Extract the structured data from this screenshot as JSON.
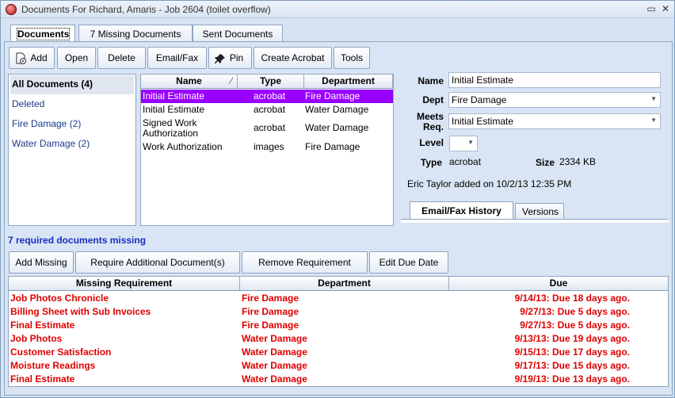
{
  "window": {
    "title": "Documents For Richard, Amaris - Job 2604 (toilet overflow)"
  },
  "tabs": [
    {
      "label": "Documents"
    },
    {
      "label": "7 Missing Documents"
    },
    {
      "label": "Sent Documents"
    }
  ],
  "toolbar": {
    "add": "Add",
    "open": "Open",
    "delete": "Delete",
    "email_fax": "Email/Fax",
    "pin": "Pin",
    "create_acrobat": "Create Acrobat",
    "tools": "Tools"
  },
  "categories": [
    {
      "label": "All Documents (4)"
    },
    {
      "label": "Deleted"
    },
    {
      "label": "Fire Damage (2)"
    },
    {
      "label": "Water Damage (2)"
    }
  ],
  "doc_grid": {
    "headers": {
      "name": "Name",
      "type": "Type",
      "department": "Department"
    },
    "rows": [
      {
        "name": "Initial Estimate",
        "type": "acrobat",
        "department": "Fire Damage"
      },
      {
        "name": "Initial Estimate",
        "type": "acrobat",
        "department": "Water Damage"
      },
      {
        "name": "Signed Work Authorization",
        "type": "acrobat",
        "department": "Water Damage"
      },
      {
        "name": "Work Authorization",
        "type": "images",
        "department": "Fire Damage"
      }
    ]
  },
  "details": {
    "name_label": "Name",
    "name_value": "Initial Estimate",
    "dept_label": "Dept",
    "dept_value": "Fire Damage",
    "meets_label_1": "Meets",
    "meets_label_2": "Req.",
    "meets_value": "Initial Estimate",
    "level_label": "Level",
    "level_value": "",
    "type_label": "Type",
    "type_value": "acrobat",
    "size_label": "Size",
    "size_value": "2334 KB",
    "added_text": "Eric Taylor added on 10/2/13 12:35 PM",
    "subtabs": [
      {
        "label": "Email/Fax History"
      },
      {
        "label": "Versions"
      }
    ]
  },
  "missing": {
    "summary": "7 required documents missing",
    "buttons": {
      "add_missing": "Add Missing",
      "require_additional": "Require Additional Document(s)",
      "remove_requirement": "Remove Requirement",
      "edit_due_date": "Edit Due Date"
    },
    "headers": {
      "requirement": "Missing Requirement",
      "department": "Department",
      "due": "Due"
    },
    "rows": [
      {
        "requirement": "Job Photos Chronicle",
        "department": "Fire Damage",
        "due": "9/14/13: Due 18 days ago."
      },
      {
        "requirement": "Billing Sheet with Sub Invoices",
        "department": "Fire Damage",
        "due": "9/27/13: Due 5 days ago."
      },
      {
        "requirement": "Final Estimate",
        "department": "Fire Damage",
        "due": "9/27/13: Due 5 days ago."
      },
      {
        "requirement": "Job Photos",
        "department": "Water Damage",
        "due": "9/13/13: Due 19 days ago."
      },
      {
        "requirement": "Customer Satisfaction",
        "department": "Water Damage",
        "due": "9/15/13: Due 17 days ago."
      },
      {
        "requirement": "Moisture Readings",
        "department": "Water Damage",
        "due": "9/17/13: Due 15 days ago."
      },
      {
        "requirement": "Final Estimate",
        "department": "Water Damage",
        "due": "9/19/13: Due 13 days ago."
      }
    ]
  },
  "colors": {
    "selection": "#9a00ff",
    "missing_text": "#e00000",
    "summary_text": "#1a2fc0"
  }
}
